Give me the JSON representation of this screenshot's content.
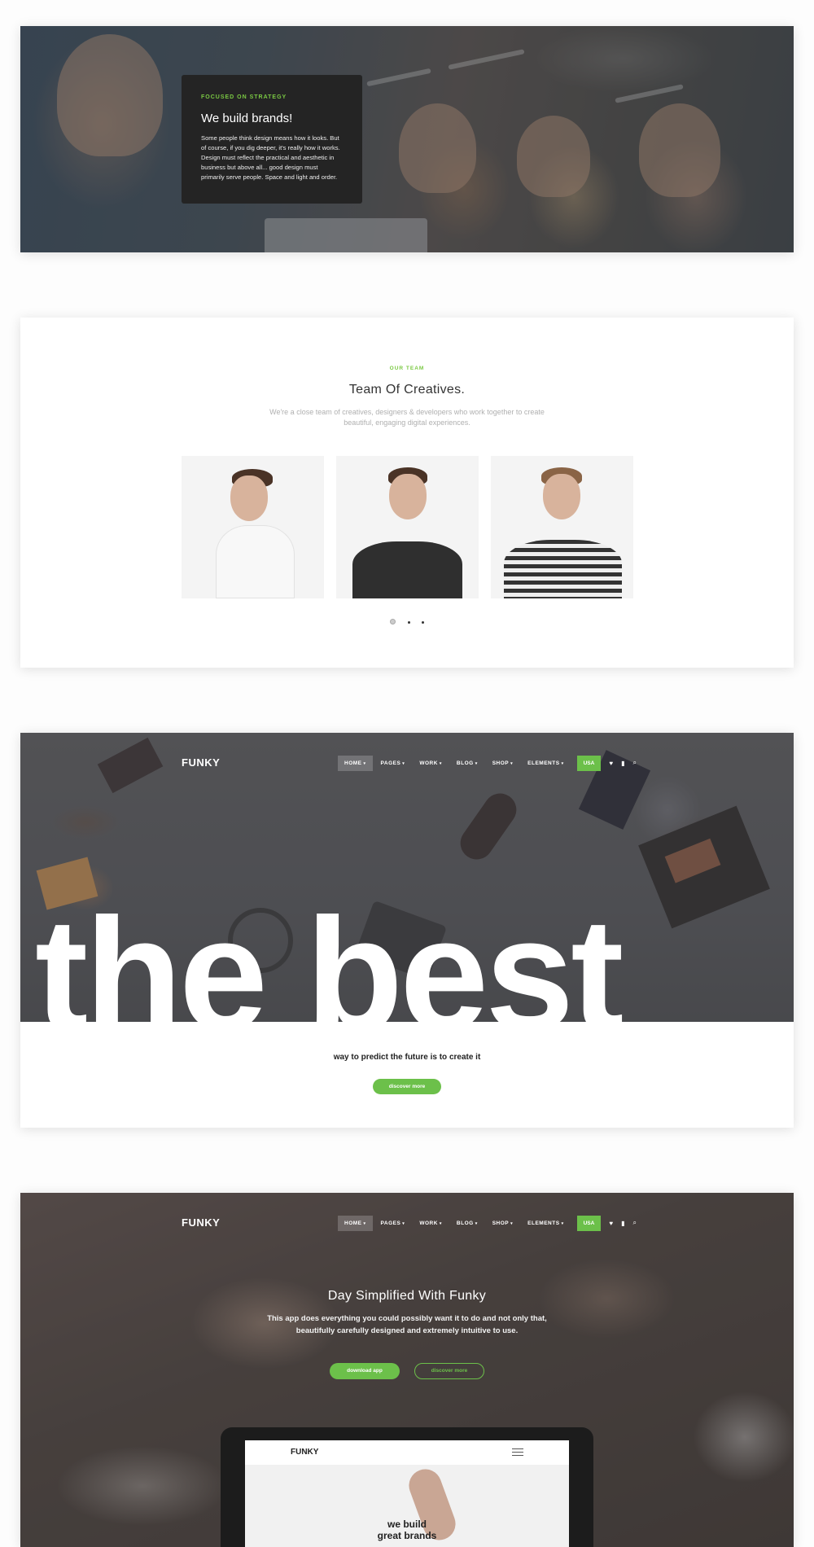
{
  "hero": {
    "eyebrow": "FOCUSED ON STRATEGY",
    "title": "We build brands!",
    "body": "Some people think design means how it looks. But of course, if you dig deeper, it's really how it works. Design must reflect the practical and aesthetic in business but above all... good design must primarily serve people. Space and light and order."
  },
  "team": {
    "eyebrow": "OUR TEAM",
    "title": "Team Of Creatives.",
    "intro": "We're a close team of creatives, designers & developers who work together to create beautiful, engaging digital experiences.",
    "carousel_active_index": 0,
    "carousel_total": 3
  },
  "nav": {
    "logo": "FUNKY",
    "items": [
      {
        "label": "HOME",
        "active": true
      },
      {
        "label": "PAGES"
      },
      {
        "label": "WORK"
      },
      {
        "label": "BLOG"
      },
      {
        "label": "SHOP"
      },
      {
        "label": "ELEMENTS"
      }
    ],
    "caret": "▾",
    "country": "USA",
    "icons": [
      "heart-icon",
      "cart-icon",
      "search-icon"
    ]
  },
  "best": {
    "headline": "the best",
    "tagline": "way to predict the future is to create it",
    "button": "discover more"
  },
  "app": {
    "title": "Day Simplified With Funky",
    "description": "This app does everything you could possibly want it to do and not only that, beautifully carefully designed and extremely intuitive to use.",
    "primary_button": "download app",
    "secondary_button": "discover more",
    "device_logo": "FUNKY",
    "device_headline_line1": "we build",
    "device_headline_line2": "great brands"
  },
  "colors": {
    "accent": "#6cc04a",
    "card_dark": "#242424"
  }
}
